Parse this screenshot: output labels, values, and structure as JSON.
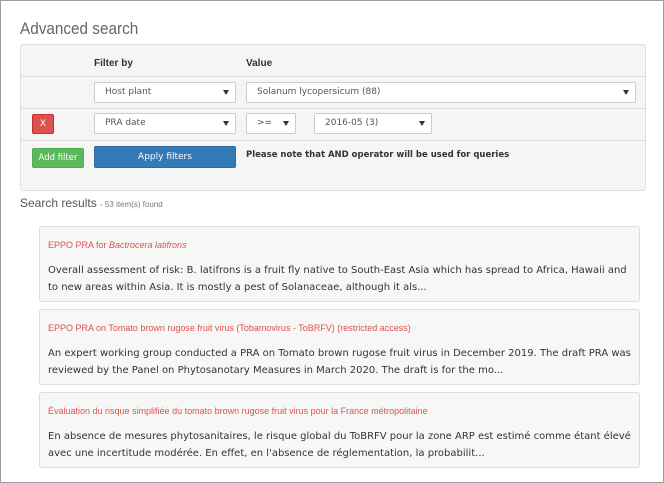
{
  "page": {
    "title": "Advanced search"
  },
  "filters": {
    "header_filter_by": "Filter by",
    "header_value": "Value",
    "row1": {
      "filter": "Host plant",
      "value": "Solanum lycopersicum (88)"
    },
    "row2": {
      "remove_label": "X",
      "filter": "PRA date",
      "operator": ">=",
      "value": "2016-05 (3)"
    },
    "add_filter_label": "Add filter",
    "apply_label": "Apply filters",
    "note": "Please note that AND operator will be used for queries"
  },
  "results": {
    "heading": "Search results",
    "count": "- 53 item(s) found",
    "items": [
      {
        "title_prefix": "EPPO PRA for ",
        "title_italic": "Bactrocera latifrons",
        "title_suffix": "",
        "desc": "Overall assessment of risk: B. latifrons is a fruit fly native to South-East Asia which has spread to Africa, Hawaii and to new areas within Asia. It is mostly a pest of Solanaceae, although it als..."
      },
      {
        "title_prefix": "EPPO PRA on Tomato brown rugose fruit virus (Tobamovirus - ToBRFV) (restricted access)",
        "title_italic": "",
        "title_suffix": "",
        "desc": "An expert working group conducted a PRA on Tomato brown rugose fruit virus in December 2019. The draft PRA was reviewed by the Panel on Phytosanotary Measures in March 2020. The draft is for the mo..."
      },
      {
        "title_prefix": "Évaluation du risque simplifiée du tomato brown rugose fruit virus pour la France métropolitaine",
        "title_italic": "",
        "title_suffix": "",
        "desc": "En absence de mesures phytosanitaires, le risque global du ToBRFV pour la zone ARP est estimé comme étant élevé avec une incertitude modérée. En effet, en l'absence de réglementation, la probabilit..."
      }
    ]
  },
  "colors": {
    "remove": "#d9534f",
    "add": "#5cb85c",
    "apply": "#337ab7",
    "result_title": "#d9534f"
  },
  "icons": {
    "select_caret": "caret-down-icon"
  }
}
